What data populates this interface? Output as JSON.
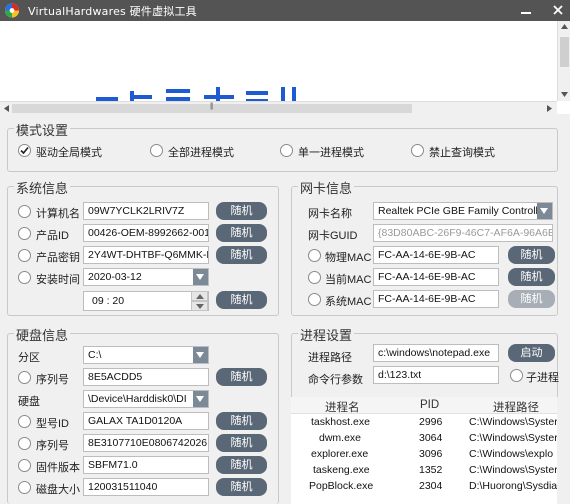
{
  "window": {
    "title": "VirtualHardwares 硬件虚拟工具"
  },
  "mode": {
    "title": "模式设置",
    "options": [
      {
        "label": "驱动全局模式",
        "checked": true
      },
      {
        "label": "全部进程模式",
        "checked": false
      },
      {
        "label": "单一进程模式",
        "checked": false
      },
      {
        "label": "禁止查询模式",
        "checked": false
      }
    ]
  },
  "system": {
    "title": "系统信息",
    "computer_name": {
      "label": "计算机名",
      "value": "09W7YCLK2LRIV7Z",
      "button": "随机"
    },
    "product_id": {
      "label": "产品ID",
      "value": "00426-OEM-8992662-0017",
      "button": "随机"
    },
    "product_key": {
      "label": "产品密钥",
      "value": "2Y4WT-DHTBF-Q6MMK-K",
      "button": "随机"
    },
    "install_time": {
      "label": "安装时间",
      "date": "2020-03-12",
      "time": "09 : 20",
      "button": "随机"
    }
  },
  "nic": {
    "title": "网卡信息",
    "name": {
      "label": "网卡名称",
      "value": "Realtek PCIe GBE Family Controll"
    },
    "guid": {
      "label": "网卡GUID",
      "value": "{83D80ABC-26F9-46C7-AF6A-96A6E7"
    },
    "physical_mac": {
      "label": "物理MAC",
      "value": "FC-AA-14-6E-9B-AC",
      "button": "随机"
    },
    "current_mac": {
      "label": "当前MAC",
      "value": "FC-AA-14-6E-9B-AC",
      "button": "随机"
    },
    "system_mac": {
      "label": "系统MAC",
      "value": "FC-AA-14-6E-9B-AC",
      "button": "随机"
    }
  },
  "disk": {
    "title": "硬盘信息",
    "partition": {
      "label": "分区",
      "value": "C:\\"
    },
    "serial": {
      "label": "序列号",
      "value": "8E5ACDD5",
      "button": "随机"
    },
    "disk": {
      "label": "硬盘",
      "value": "\\Device\\Harddisk0\\DI"
    },
    "model": {
      "label": "型号ID",
      "value": "GALAX TA1D0120A",
      "button": "随机"
    },
    "disk_serial": {
      "label": "序列号",
      "value": "8E3107710E0806742026",
      "button": "随机"
    },
    "firmware": {
      "label": "固件版本",
      "value": "SBFM71.0",
      "button": "随机"
    },
    "size": {
      "label": "磁盘大小",
      "value": "120031511040",
      "button": "随机"
    }
  },
  "process": {
    "title": "进程设置",
    "path": {
      "label": "进程路径",
      "value": "c:\\windows\\notepad.exe",
      "button": "启动"
    },
    "args": {
      "label": "命令行参数",
      "value": "d:\\123.txt",
      "checkbox": "子进程"
    },
    "columns": [
      "进程名",
      "PID",
      "进程路径"
    ],
    "rows": [
      {
        "name": "taskhost.exe",
        "pid": "2996",
        "path": "C:\\Windows\\Syster"
      },
      {
        "name": "dwm.exe",
        "pid": "3064",
        "path": "C:\\Windows\\Syster"
      },
      {
        "name": "explorer.exe",
        "pid": "3096",
        "path": "C:\\Windows\\explo"
      },
      {
        "name": "taskeng.exe",
        "pid": "1352",
        "path": "C:\\Windows\\Syster"
      },
      {
        "name": "PopBlock.exe",
        "pid": "2304",
        "path": "D:\\Huorong\\Sysdia"
      }
    ]
  },
  "colors": {
    "button": "#5a6776",
    "titlebar": "#545454",
    "banner_art": "#1e5ad2"
  }
}
